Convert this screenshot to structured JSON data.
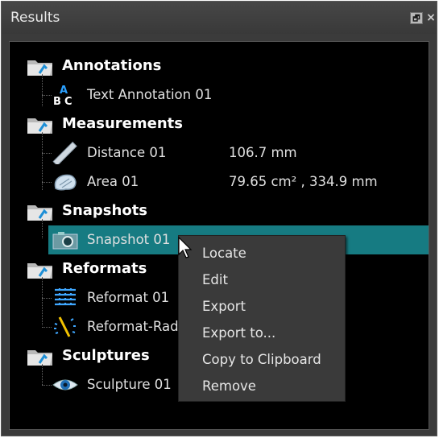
{
  "window": {
    "title": "Results",
    "float_glyph": "🗗",
    "close_glyph": "×"
  },
  "tree": {
    "groups": [
      {
        "label": "Annotations",
        "items": [
          {
            "label": "Text Annotation 01",
            "value": "",
            "icon": "text-annotation-icon"
          }
        ]
      },
      {
        "label": "Measurements",
        "items": [
          {
            "label": "Distance 01",
            "value": "106.7 mm",
            "icon": "ruler-icon"
          },
          {
            "label": "Area 01",
            "value": "79.65 cm² , 334.9 mm",
            "icon": "area-icon"
          }
        ]
      },
      {
        "label": "Snapshots",
        "items": [
          {
            "label": "Snapshot 01",
            "value": "",
            "icon": "camera-icon",
            "selected": true
          }
        ]
      },
      {
        "label": "Reformats",
        "items": [
          {
            "label": "Reformat 01",
            "value": "",
            "icon": "reformat-icon"
          },
          {
            "label": "Reformat-Rad",
            "value": "",
            "icon": "radial-reformat-icon"
          }
        ]
      },
      {
        "label": "Sculptures",
        "items": [
          {
            "label": "Sculpture 01",
            "value": "",
            "icon": "eye-icon"
          }
        ]
      }
    ]
  },
  "context_menu": {
    "items": [
      "Locate",
      "Edit",
      "Export",
      "Export to...",
      "Copy to Clipboard",
      "Remove"
    ]
  },
  "colors": {
    "selection": "#167b82",
    "panel": "#3b3b3b",
    "tree_bg": "#000000"
  }
}
